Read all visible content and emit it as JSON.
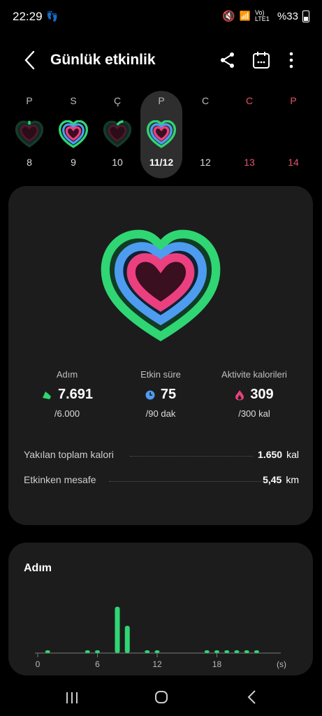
{
  "status_bar": {
    "time": "22:29",
    "steps_icon": "footsteps-icon",
    "battery": "%33",
    "network": "Vo) LTE1"
  },
  "header": {
    "title": "Günlük etkinlik",
    "icons": [
      "back-icon",
      "share-icon",
      "calendar-icon",
      "more-icon"
    ]
  },
  "week": [
    {
      "letter": "P",
      "num": "8",
      "selected": false,
      "weekend": false
    },
    {
      "letter": "S",
      "num": "9",
      "selected": false,
      "weekend": false
    },
    {
      "letter": "Ç",
      "num": "10",
      "selected": false,
      "weekend": false
    },
    {
      "letter": "P",
      "num": "11/12",
      "selected": true,
      "weekend": false
    },
    {
      "letter": "C",
      "num": "12",
      "selected": false,
      "weekend": false
    },
    {
      "letter": "C",
      "num": "13",
      "selected": false,
      "weekend": true
    },
    {
      "letter": "P",
      "num": "14",
      "selected": false,
      "weekend": true
    }
  ],
  "summary": {
    "steps": {
      "label": "Adım",
      "value": "7.691",
      "goal": "/6.000"
    },
    "active": {
      "label": "Etkin süre",
      "value": "75",
      "goal": "/90 dak"
    },
    "calories": {
      "label": "Aktivite kalorileri",
      "value": "309",
      "goal": "/300 kal"
    }
  },
  "details": [
    {
      "label": "Yakılan toplam kalori",
      "value": "1.650",
      "unit": "kal"
    },
    {
      "label": "Etkinken mesafe",
      "value": "5,45",
      "unit": "km"
    }
  ],
  "colors": {
    "green": "#2fd673",
    "blue": "#4e9cf0",
    "pink": "#ec3f80",
    "red_day": "#e0556b"
  },
  "chart_data": {
    "type": "bar",
    "title": "Adım",
    "x_ticks": [
      "0",
      "6",
      "12",
      "18"
    ],
    "x_unit": "(s)",
    "xlim": [
      0,
      24
    ],
    "ylim": [
      0,
      1000
    ],
    "x": [
      1,
      5,
      6,
      8,
      9,
      11,
      12,
      17,
      18,
      19,
      20,
      21,
      22
    ],
    "values": [
      10,
      10,
      10,
      850,
      500,
      10,
      10,
      10,
      10,
      10,
      10,
      10,
      10
    ]
  }
}
